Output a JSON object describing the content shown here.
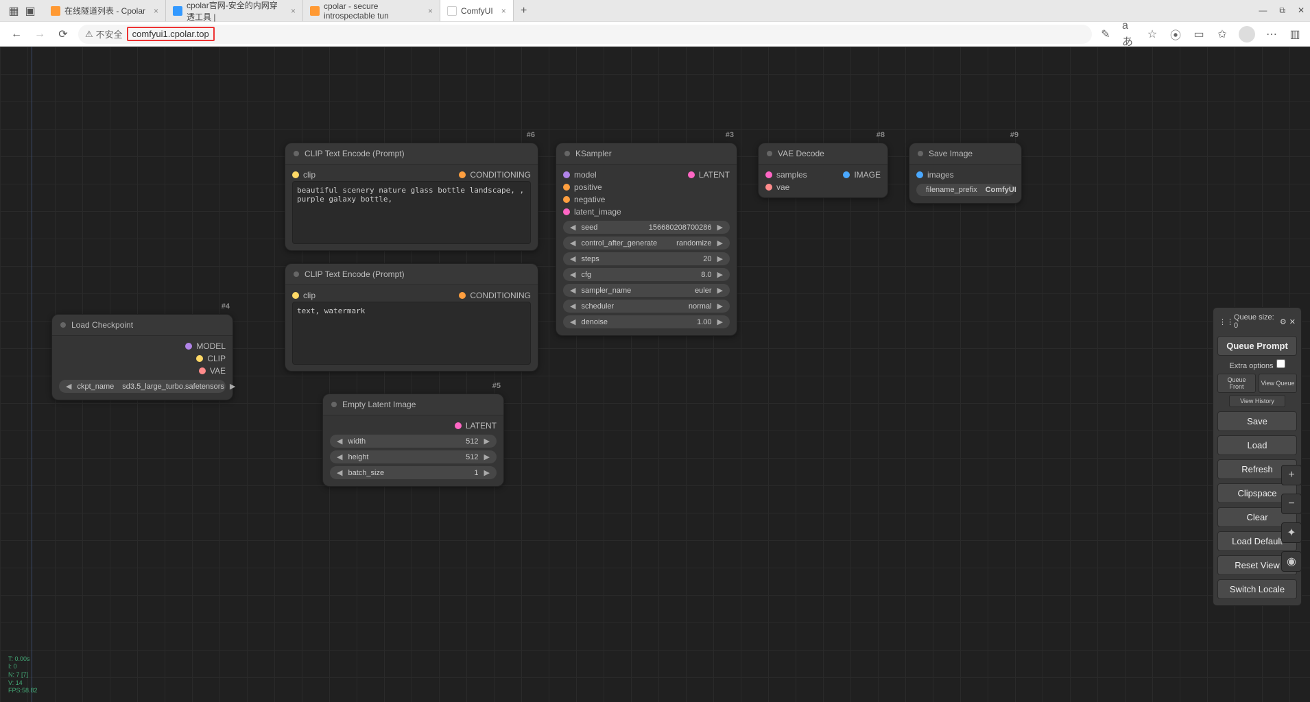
{
  "browser": {
    "tabs": [
      {
        "label": "在线隧道列表 - Cpolar",
        "favicon": "#ff9933"
      },
      {
        "label": "cpolar官网-安全的内网穿透工具 |",
        "favicon": "#3399ff"
      },
      {
        "label": "cpolar - secure introspectable tun",
        "favicon": "#ff9933"
      },
      {
        "label": "ComfyUI",
        "favicon": "#ffffff"
      }
    ],
    "insecure_label": "不安全",
    "url": "comfyui1.cpolar.top",
    "aA": "aあ"
  },
  "nodes": {
    "load_ckpt": {
      "id": "#4",
      "title": "Load Checkpoint",
      "outs": [
        "MODEL",
        "CLIP",
        "VAE"
      ],
      "ckpt_label": "ckpt_name",
      "ckpt_val": "sd3.5_large_turbo.safetensors"
    },
    "clip_pos": {
      "id": "#6",
      "title": "CLIP Text Encode (Prompt)",
      "in": "clip",
      "out": "CONDITIONING",
      "text": "beautiful scenery nature glass bottle landscape, , purple galaxy bottle,"
    },
    "clip_neg": {
      "id": "",
      "title": "CLIP Text Encode (Prompt)",
      "in": "clip",
      "out": "CONDITIONING",
      "text": "text, watermark"
    },
    "empty_latent": {
      "id": "#5",
      "title": "Empty Latent Image",
      "out": "LATENT",
      "widgets": [
        {
          "label": "width",
          "val": "512"
        },
        {
          "label": "height",
          "val": "512"
        },
        {
          "label": "batch_size",
          "val": "1"
        }
      ]
    },
    "ksampler": {
      "id": "#3",
      "title": "KSampler",
      "ins": [
        "model",
        "positive",
        "negative",
        "latent_image"
      ],
      "out": "LATENT",
      "widgets": [
        {
          "label": "seed",
          "val": "156680208700286"
        },
        {
          "label": "control_after_generate",
          "val": "randomize"
        },
        {
          "label": "steps",
          "val": "20"
        },
        {
          "label": "cfg",
          "val": "8.0"
        },
        {
          "label": "sampler_name",
          "val": "euler"
        },
        {
          "label": "scheduler",
          "val": "normal"
        },
        {
          "label": "denoise",
          "val": "1.00"
        }
      ]
    },
    "vae_decode": {
      "id": "#8",
      "title": "VAE Decode",
      "ins": [
        "samples",
        "vae"
      ],
      "out": "IMAGE"
    },
    "save_image": {
      "id": "#9",
      "title": "Save Image",
      "in": "images",
      "prefix_label": "filename_prefix",
      "prefix_val": "ComfyUI"
    }
  },
  "panel": {
    "queue_label": "Queue size: 0",
    "queue_prompt": "Queue Prompt",
    "extra_options": "Extra options",
    "queue_front": "Queue Front",
    "view_queue": "View Queue",
    "view_history": "View History",
    "buttons": [
      "Save",
      "Load",
      "Refresh",
      "Clipspace",
      "Clear",
      "Load Default",
      "Reset View",
      "Switch Locale"
    ]
  },
  "stats": {
    "l1": "T: 0.00s",
    "l2": "I: 0",
    "l3": "N: 7 [7]",
    "l4": "V: 14",
    "l5": "FPS:58.82"
  }
}
